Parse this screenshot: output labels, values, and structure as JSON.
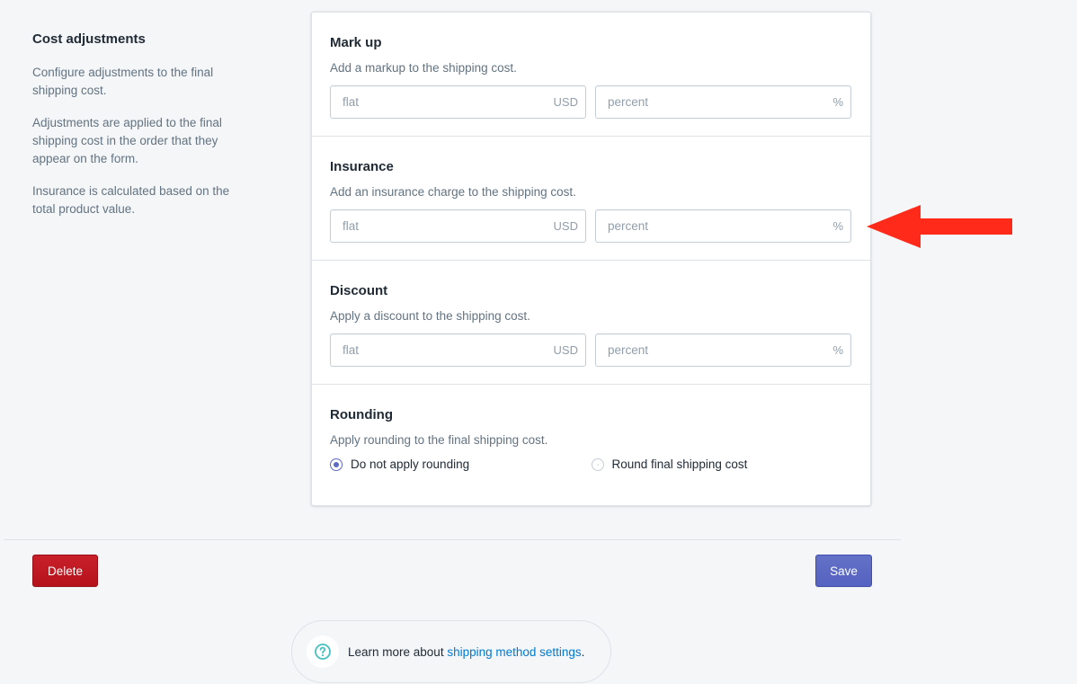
{
  "aside": {
    "title": "Cost adjustments",
    "paragraphs": [
      "Configure adjustments to the final shipping cost.",
      "Adjustments are applied to the final shipping cost in the order that they appear on the form.",
      "Insurance is calculated based on the total product value."
    ]
  },
  "sections": [
    {
      "title": "Mark up",
      "description": "Add a markup to the shipping cost.",
      "flat_placeholder": "flat",
      "flat_suffix": "USD",
      "percent_placeholder": "percent",
      "percent_suffix": "%"
    },
    {
      "title": "Insurance",
      "description": "Add an insurance charge to the shipping cost.",
      "flat_placeholder": "flat",
      "flat_suffix": "USD",
      "percent_placeholder": "percent",
      "percent_suffix": "%"
    },
    {
      "title": "Discount",
      "description": "Apply a discount to the shipping cost.",
      "flat_placeholder": "flat",
      "flat_suffix": "USD",
      "percent_placeholder": "percent",
      "percent_suffix": "%"
    }
  ],
  "rounding": {
    "title": "Rounding",
    "description": "Apply rounding to the final shipping cost.",
    "options": [
      {
        "label": "Do not apply rounding",
        "checked": true
      },
      {
        "label": "Round final shipping cost",
        "checked": false
      }
    ]
  },
  "actions": {
    "delete_label": "Delete",
    "save_label": "Save"
  },
  "help": {
    "prefix": "Learn more about ",
    "link_text": "shipping method settings",
    "suffix": "."
  },
  "colors": {
    "accent": "#5c6ac4",
    "danger": "#bf0711",
    "link": "#007ace",
    "help_icon": "#47c1bf",
    "annotation_arrow": "#ff2a1a"
  },
  "icons": {
    "help": "question-circle-icon",
    "annotation": "arrow-left-icon"
  }
}
